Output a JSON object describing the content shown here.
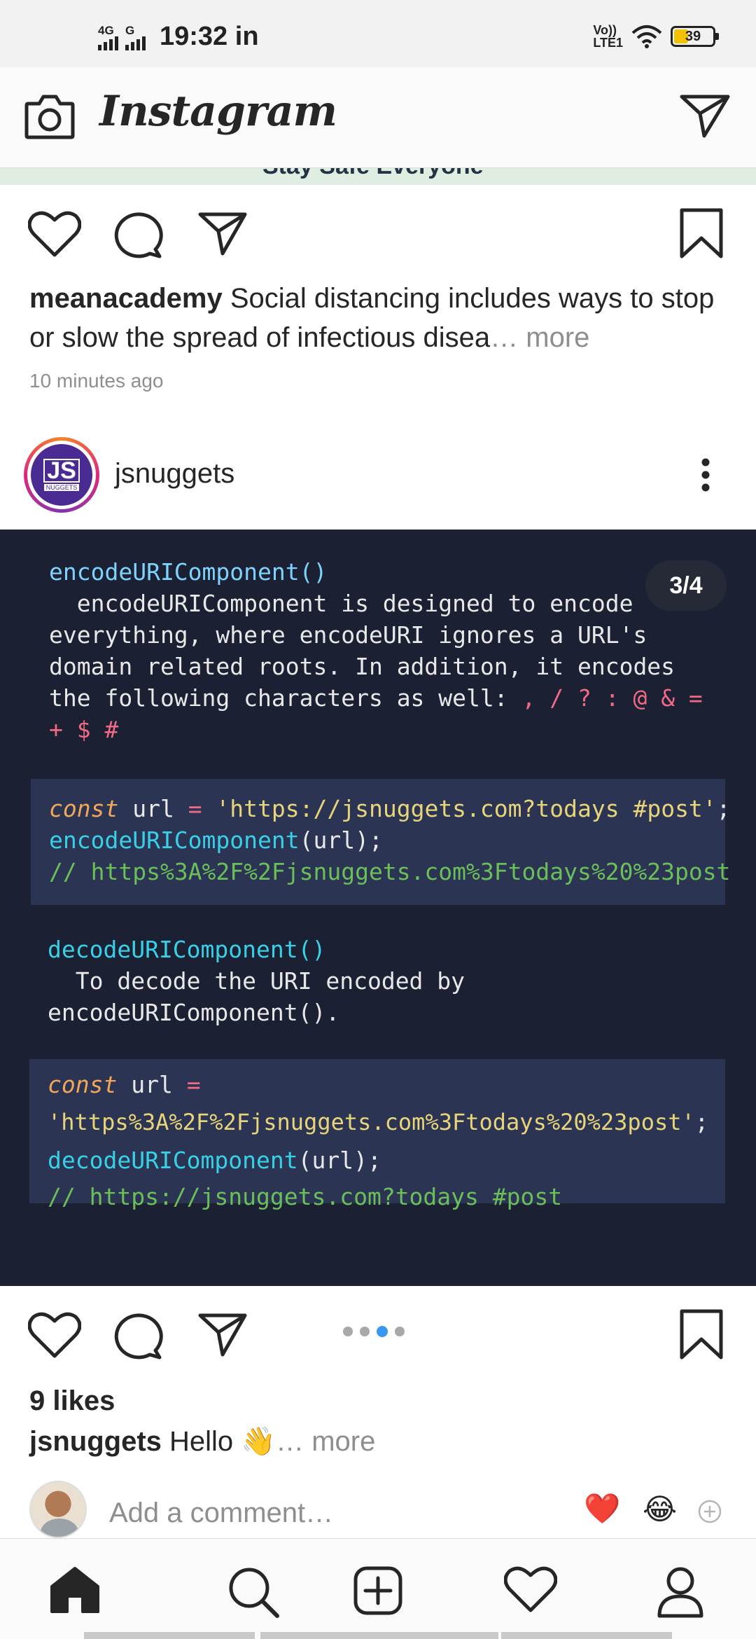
{
  "status_bar": {
    "network_1": "4G",
    "network_2": "G",
    "time": "19:32",
    "carrier_tag": "in",
    "volte_1": "Vo))",
    "volte_2": "LTE1",
    "battery": "39"
  },
  "header": {
    "app_name": "Instagram"
  },
  "previous_post": {
    "strip_text": "Stay Safe Everyone",
    "username": "meanacademy",
    "caption": " Social distancing includes ways to stop or slow the spread of infectious disea",
    "more_label": "… more",
    "time_ago": "10 minutes ago"
  },
  "post": {
    "username": "jsnuggets",
    "avatar_text": "JS",
    "avatar_subtext": "NUGGETS",
    "counter": "3/4",
    "slide": {
      "title1": "encodeURIComponent()",
      "para1": [
        "  encodeURIComponent is designed to encode",
        "everything, where encodeURI ignores a URL's",
        "domain related roots. In addition, it encodes",
        "the following characters as well: "
      ],
      "chars_a": ", / ? : @ & =",
      "chars_b": "+ $ #",
      "code1": {
        "kw": "const",
        "var": " url ",
        "op": "=",
        "str": " 'https://jsnuggets.com?todays #post'",
        "end": ";",
        "fn": "encodeURIComponent",
        "args": "(url);",
        "comment": "// https%3A%2F%2Fjsnuggets.com%3Ftodays%20%23post"
      },
      "title2": "decodeURIComponent()",
      "para2": [
        "  To decode the URI encoded by",
        "encodeURIComponent()."
      ],
      "code2": {
        "kw": "const",
        "var": " url ",
        "op": "=",
        "str": "'https%3A%2F%2Fjsnuggets.com%3Ftodays%20%23post'",
        "end": ";",
        "fn": "decodeURIComponent",
        "args": "(url);",
        "comment": "// https://jsnuggets.com?todays #post"
      }
    },
    "carousel": {
      "count": 4,
      "active_index": 2
    },
    "likes": "9 likes",
    "caption_user": "jsnuggets",
    "caption_text": " Hello 👋",
    "more_label": "… more",
    "comment_placeholder": "Add a comment…",
    "reactions": [
      "❤️",
      "😂"
    ]
  },
  "colors": {
    "code_bg": "#1c2033",
    "code_block_bg": "#2b3553",
    "accent_blue": "#3897f0"
  },
  "icons": {
    "header_left": "camera-icon",
    "header_right": "direct-send-icon",
    "nav": [
      "home-icon",
      "search-icon",
      "add-post-icon",
      "activity-heart-icon",
      "profile-icon"
    ]
  }
}
